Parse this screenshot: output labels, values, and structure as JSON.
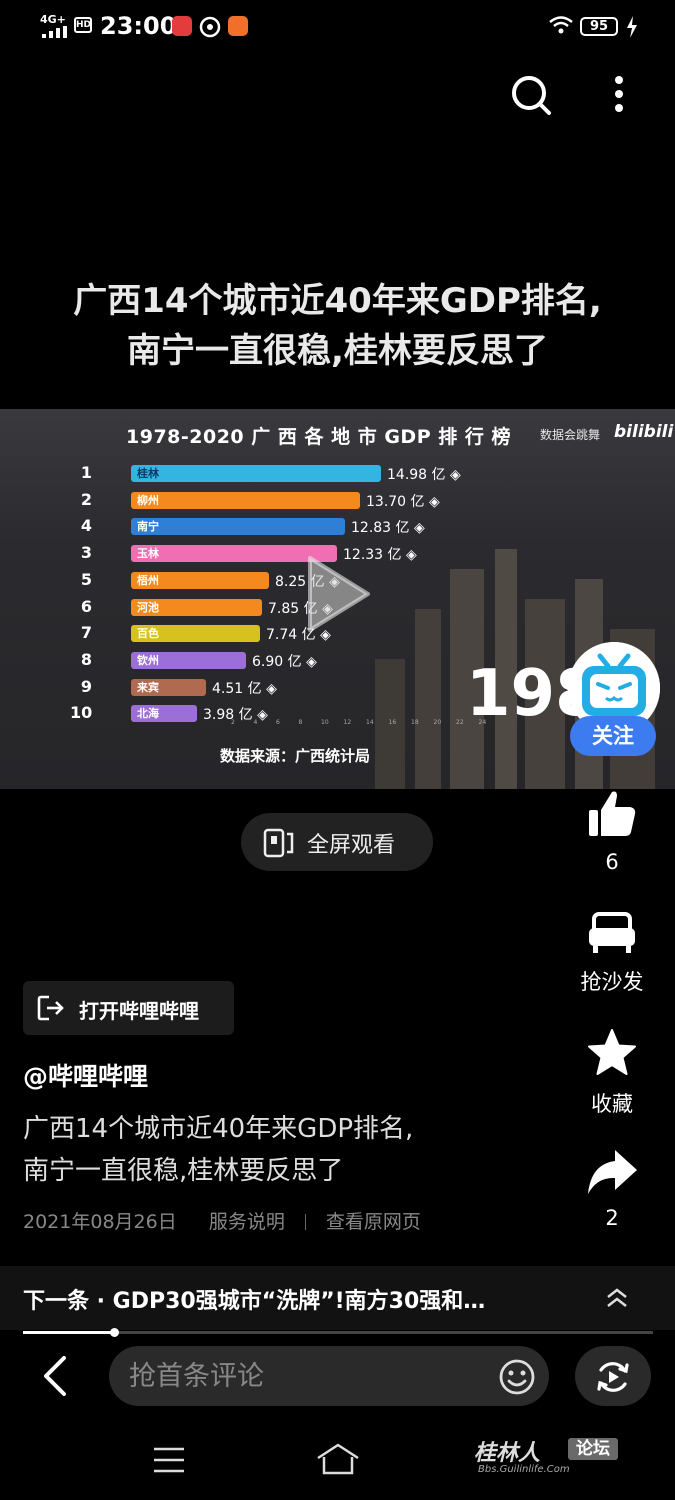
{
  "status_bar": {
    "network": "4G+",
    "hd": "HD",
    "time": "23:00",
    "battery": "95"
  },
  "post": {
    "title_line1": "广西14个城市近40年来GDP排名,",
    "title_line2": "南宁一直很稳,桂林要反思了",
    "author": "@哔哩哔哩",
    "desc_line1": "广西14个城市近40年来GDP排名,",
    "desc_line2": "南宁一直很稳,桂林要反思了",
    "date": "2021年08月26日",
    "service_link": "服务说明",
    "source_link": "查看原网页"
  },
  "video": {
    "title": "1978-2020 广 西 各 地 市 GDP 排 行 榜",
    "credit": "数据会跳舞",
    "logo": "bilibili",
    "source_note": "数据来源：广西统计局",
    "year": "198",
    "axis_ticks": [
      "2",
      "4",
      "6",
      "8",
      "10",
      "12",
      "14",
      "16",
      "18",
      "20",
      "22",
      "24"
    ]
  },
  "chart_data": {
    "type": "bar",
    "title": "1978-2020 广 西 各 地 市 GDP 排 行 榜",
    "ranks": [
      "1",
      "2",
      "4",
      "3",
      "5",
      "6",
      "7",
      "8",
      "9",
      "10"
    ],
    "categories": [
      "桂林",
      "柳州",
      "南宁",
      "玉林",
      "梧州",
      "河池",
      "百色",
      "钦州",
      "来宾",
      "北海"
    ],
    "values": [
      14.98,
      13.7,
      12.83,
      12.33,
      8.25,
      7.85,
      7.74,
      6.9,
      4.51,
      3.98
    ],
    "value_labels": [
      "14.98 亿",
      "13.70 亿",
      "12.83 亿",
      "12.33 亿",
      "8.25 亿",
      "7.85 亿",
      "7.74 亿",
      "6.90 亿",
      "4.51 亿",
      "3.98 亿"
    ],
    "colors": [
      "#34b4e0",
      "#f48a1e",
      "#2f7fd6",
      "#f06fb2",
      "#f48a1e",
      "#f48a1e",
      "#d6c21e",
      "#9c6fd6",
      "#b06a50",
      "#9c6fd6"
    ],
    "xlim": [
      0,
      24
    ]
  },
  "actions": {
    "follow": "关注",
    "fullscreen": "全屏观看",
    "like_count": "6",
    "sofa": "抢沙发",
    "favorite": "收藏",
    "share_count": "2",
    "open_app": "打开哔哩哔哩"
  },
  "next": {
    "text": "下一条 · GDP30强城市“洗牌”!南方30强和…",
    "progress": 0.144
  },
  "comment": {
    "placeholder": "抢首条评论"
  },
  "watermark": {
    "main": "桂林人",
    "tag": "论坛",
    "sub": "Bbs.Guilinlife.Com"
  },
  "colors": {
    "accent_blue": "#3d7bf0",
    "bilibili_blue": "#23ade5"
  }
}
